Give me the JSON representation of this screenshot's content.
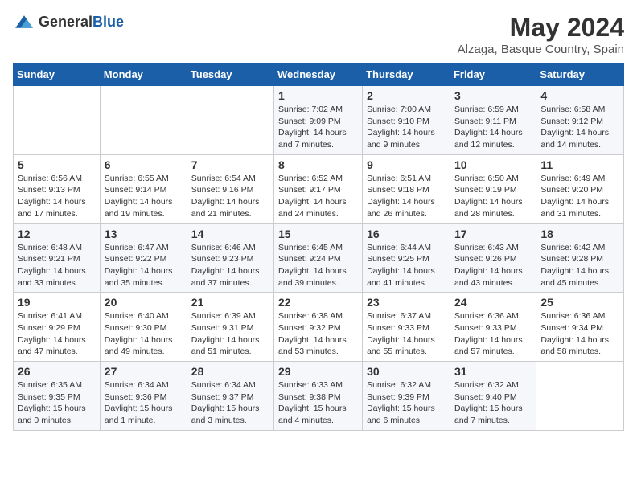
{
  "header": {
    "logo_general": "General",
    "logo_blue": "Blue",
    "month": "May 2024",
    "location": "Alzaga, Basque Country, Spain"
  },
  "weekdays": [
    "Sunday",
    "Monday",
    "Tuesday",
    "Wednesday",
    "Thursday",
    "Friday",
    "Saturday"
  ],
  "weeks": [
    [
      {
        "day": "",
        "info": ""
      },
      {
        "day": "",
        "info": ""
      },
      {
        "day": "",
        "info": ""
      },
      {
        "day": "1",
        "info": "Sunrise: 7:02 AM\nSunset: 9:09 PM\nDaylight: 14 hours and 7 minutes."
      },
      {
        "day": "2",
        "info": "Sunrise: 7:00 AM\nSunset: 9:10 PM\nDaylight: 14 hours and 9 minutes."
      },
      {
        "day": "3",
        "info": "Sunrise: 6:59 AM\nSunset: 9:11 PM\nDaylight: 14 hours and 12 minutes."
      },
      {
        "day": "4",
        "info": "Sunrise: 6:58 AM\nSunset: 9:12 PM\nDaylight: 14 hours and 14 minutes."
      }
    ],
    [
      {
        "day": "5",
        "info": "Sunrise: 6:56 AM\nSunset: 9:13 PM\nDaylight: 14 hours and 17 minutes."
      },
      {
        "day": "6",
        "info": "Sunrise: 6:55 AM\nSunset: 9:14 PM\nDaylight: 14 hours and 19 minutes."
      },
      {
        "day": "7",
        "info": "Sunrise: 6:54 AM\nSunset: 9:16 PM\nDaylight: 14 hours and 21 minutes."
      },
      {
        "day": "8",
        "info": "Sunrise: 6:52 AM\nSunset: 9:17 PM\nDaylight: 14 hours and 24 minutes."
      },
      {
        "day": "9",
        "info": "Sunrise: 6:51 AM\nSunset: 9:18 PM\nDaylight: 14 hours and 26 minutes."
      },
      {
        "day": "10",
        "info": "Sunrise: 6:50 AM\nSunset: 9:19 PM\nDaylight: 14 hours and 28 minutes."
      },
      {
        "day": "11",
        "info": "Sunrise: 6:49 AM\nSunset: 9:20 PM\nDaylight: 14 hours and 31 minutes."
      }
    ],
    [
      {
        "day": "12",
        "info": "Sunrise: 6:48 AM\nSunset: 9:21 PM\nDaylight: 14 hours and 33 minutes."
      },
      {
        "day": "13",
        "info": "Sunrise: 6:47 AM\nSunset: 9:22 PM\nDaylight: 14 hours and 35 minutes."
      },
      {
        "day": "14",
        "info": "Sunrise: 6:46 AM\nSunset: 9:23 PM\nDaylight: 14 hours and 37 minutes."
      },
      {
        "day": "15",
        "info": "Sunrise: 6:45 AM\nSunset: 9:24 PM\nDaylight: 14 hours and 39 minutes."
      },
      {
        "day": "16",
        "info": "Sunrise: 6:44 AM\nSunset: 9:25 PM\nDaylight: 14 hours and 41 minutes."
      },
      {
        "day": "17",
        "info": "Sunrise: 6:43 AM\nSunset: 9:26 PM\nDaylight: 14 hours and 43 minutes."
      },
      {
        "day": "18",
        "info": "Sunrise: 6:42 AM\nSunset: 9:28 PM\nDaylight: 14 hours and 45 minutes."
      }
    ],
    [
      {
        "day": "19",
        "info": "Sunrise: 6:41 AM\nSunset: 9:29 PM\nDaylight: 14 hours and 47 minutes."
      },
      {
        "day": "20",
        "info": "Sunrise: 6:40 AM\nSunset: 9:30 PM\nDaylight: 14 hours and 49 minutes."
      },
      {
        "day": "21",
        "info": "Sunrise: 6:39 AM\nSunset: 9:31 PM\nDaylight: 14 hours and 51 minutes."
      },
      {
        "day": "22",
        "info": "Sunrise: 6:38 AM\nSunset: 9:32 PM\nDaylight: 14 hours and 53 minutes."
      },
      {
        "day": "23",
        "info": "Sunrise: 6:37 AM\nSunset: 9:33 PM\nDaylight: 14 hours and 55 minutes."
      },
      {
        "day": "24",
        "info": "Sunrise: 6:36 AM\nSunset: 9:33 PM\nDaylight: 14 hours and 57 minutes."
      },
      {
        "day": "25",
        "info": "Sunrise: 6:36 AM\nSunset: 9:34 PM\nDaylight: 14 hours and 58 minutes."
      }
    ],
    [
      {
        "day": "26",
        "info": "Sunrise: 6:35 AM\nSunset: 9:35 PM\nDaylight: 15 hours and 0 minutes."
      },
      {
        "day": "27",
        "info": "Sunrise: 6:34 AM\nSunset: 9:36 PM\nDaylight: 15 hours and 1 minute."
      },
      {
        "day": "28",
        "info": "Sunrise: 6:34 AM\nSunset: 9:37 PM\nDaylight: 15 hours and 3 minutes."
      },
      {
        "day": "29",
        "info": "Sunrise: 6:33 AM\nSunset: 9:38 PM\nDaylight: 15 hours and 4 minutes."
      },
      {
        "day": "30",
        "info": "Sunrise: 6:32 AM\nSunset: 9:39 PM\nDaylight: 15 hours and 6 minutes."
      },
      {
        "day": "31",
        "info": "Sunrise: 6:32 AM\nSunset: 9:40 PM\nDaylight: 15 hours and 7 minutes."
      },
      {
        "day": "",
        "info": ""
      }
    ]
  ]
}
